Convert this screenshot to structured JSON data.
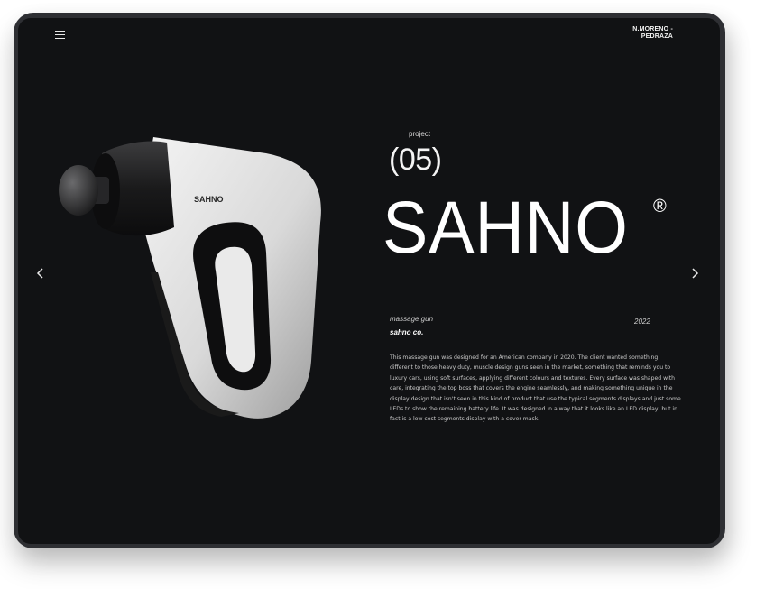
{
  "brand": {
    "line1": "N.MORENO -",
    "line2": "PEDRAZA"
  },
  "project": {
    "label": "project",
    "number": "(05)",
    "title": "SAHNO",
    "registered": "®",
    "category": "massage gun",
    "year": "2022",
    "client": "sahno co.",
    "description": "This massage gun was designed for an American company in 2020. The client wanted something different to those heavy duty, muscle design guns seen in the market,  something that reminds you to luxury cars, using soft surfaces, applying different colours and textures. Every surface was shaped with care, integrating the top boss that covers the engine seamlessly, and making something unique in the display design that isn't seen in this kind of product that use the typical segments displays and just some LEDs to show the remaining battery life. It was designed in a way that it looks like an LED display, but in fact is a low cost segments display with a cover mask."
  },
  "product_image": {
    "logo_text": "SAHNO"
  },
  "icons": {
    "menu": "hamburger-menu-icon",
    "prev": "chevron-left-icon",
    "next": "chevron-right-icon"
  },
  "colors": {
    "screen_background": "#111214",
    "device_frame": "#2e2f33",
    "text_primary": "#ffffff",
    "text_secondary": "#c9c9c9"
  }
}
